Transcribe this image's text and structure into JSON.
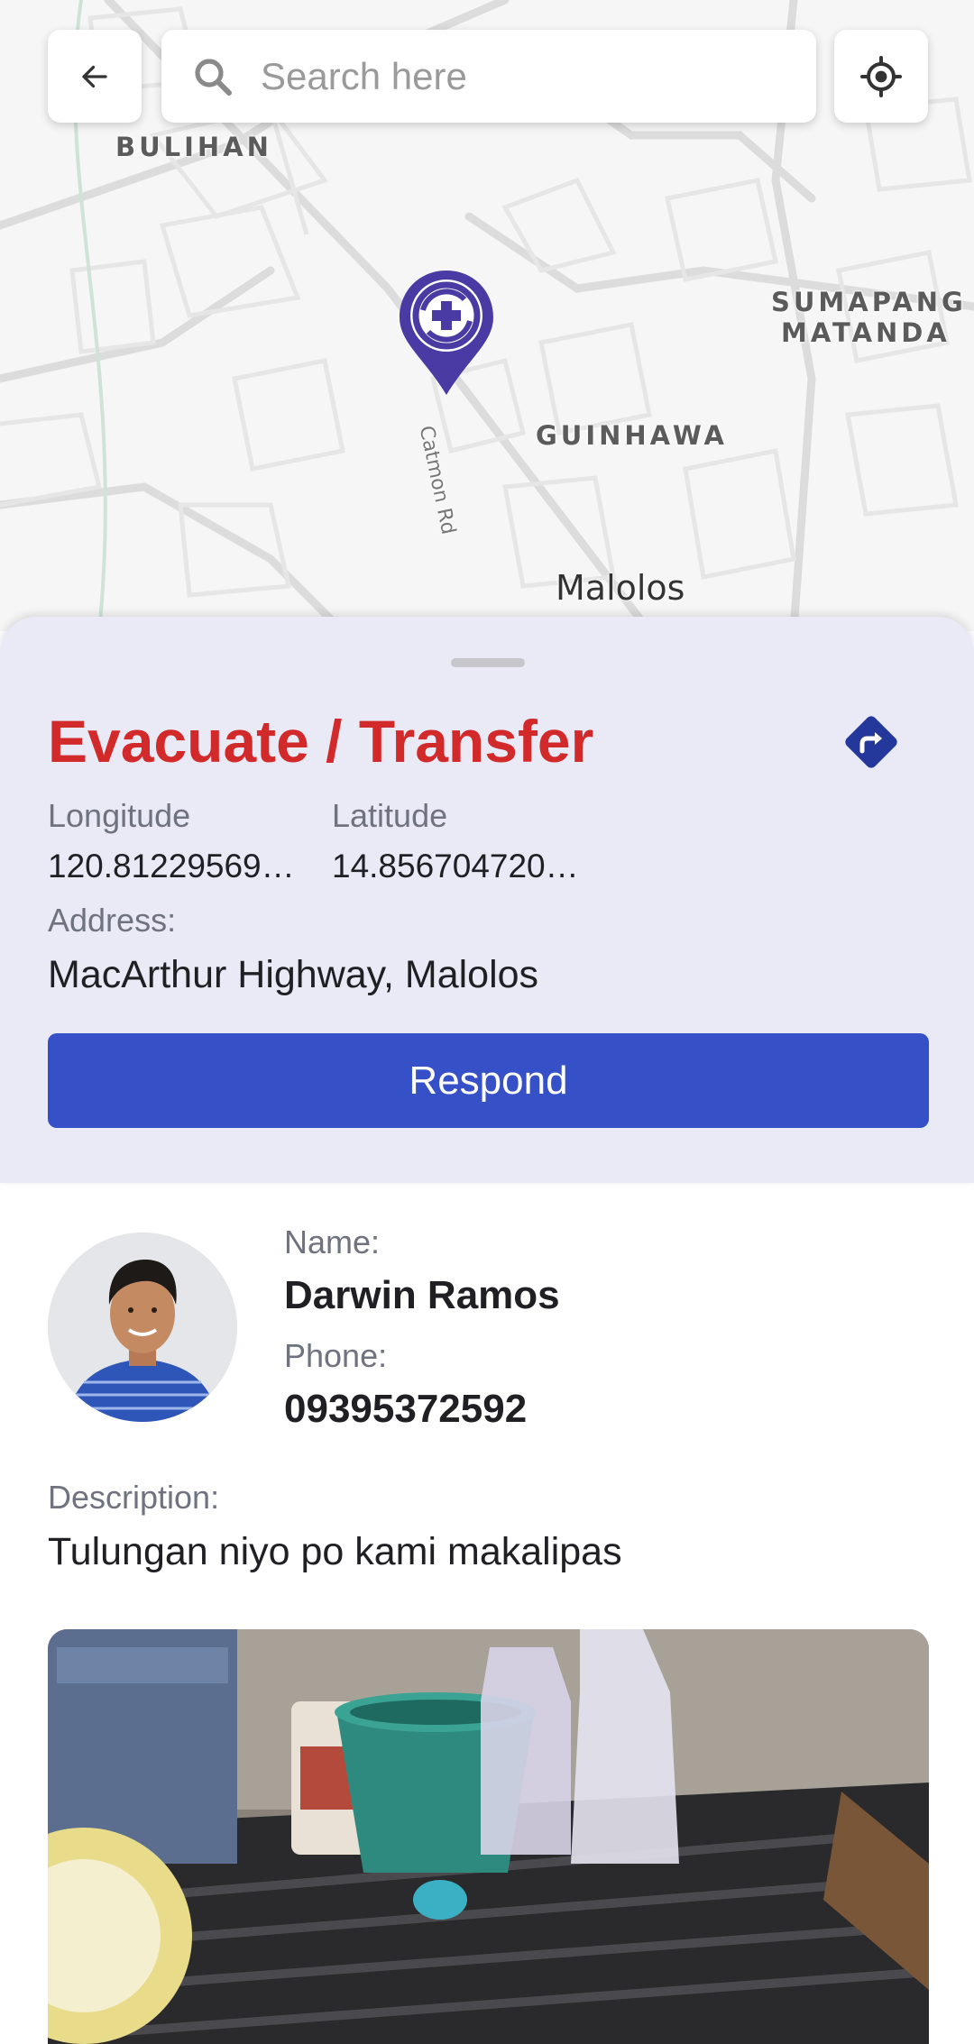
{
  "map": {
    "search_placeholder": "Search here",
    "labels": {
      "bulihan": "BULIHAN",
      "sumapang": "SUMAPANG",
      "matanda": "MATANDA",
      "guinhawa": "GUINHAWA",
      "malolos": "Malolos",
      "catmon_rd": "Catmon Rd"
    }
  },
  "incident": {
    "type": "Evacuate / Transfer",
    "longitude_label": "Longitude",
    "longitude": "120.812295693…",
    "latitude_label": "Latitude",
    "latitude": "14.8567047200…",
    "address_label": "Address:",
    "address": "MacArthur Highway, Malolos",
    "respond_label": "Respond"
  },
  "reporter": {
    "name_label": "Name:",
    "name": "Darwin Ramos",
    "phone_label": "Phone:",
    "phone": "09395372592",
    "description_label": "Description:",
    "description": "Tulungan niyo po kami makalipas"
  },
  "colors": {
    "title_red": "#d22a2a",
    "primary_blue": "#3650c8",
    "panel_bg": "#e9eaf6",
    "pin_purple": "#4a3aa3",
    "direction_icon": "#23389a"
  },
  "icons": {
    "back": "arrow-left-icon",
    "search": "search-icon",
    "locate": "crosshair-icon",
    "pin": "map-pin-icon",
    "directions": "directions-icon"
  }
}
